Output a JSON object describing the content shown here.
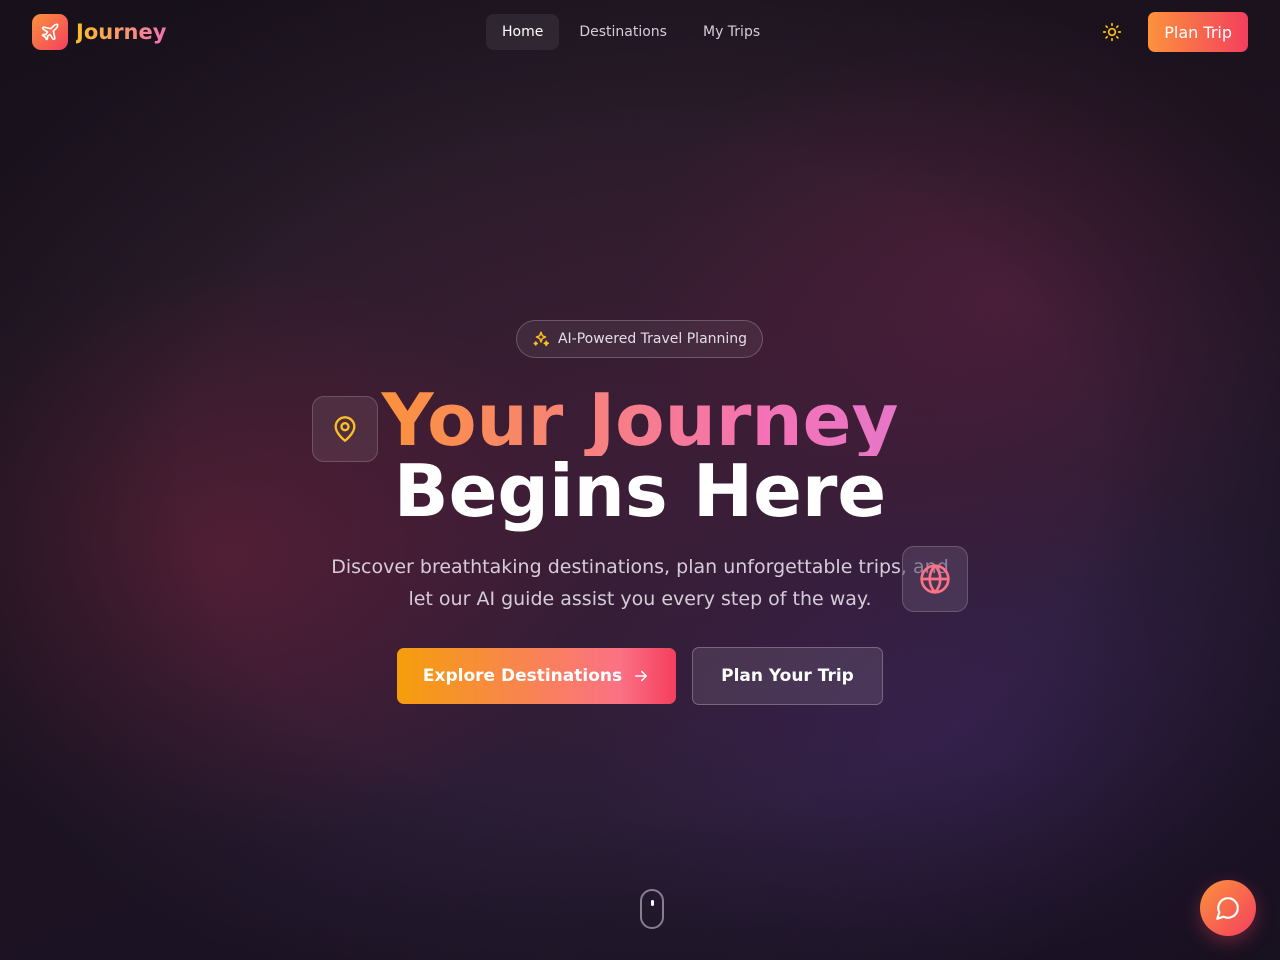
{
  "brand": {
    "name": "Journey",
    "icon": "plane-icon"
  },
  "nav": {
    "items": [
      {
        "label": "Home",
        "active": true
      },
      {
        "label": "Destinations",
        "active": false
      },
      {
        "label": "My Trips",
        "active": false
      }
    ]
  },
  "header": {
    "theme_toggle_icon": "sun-icon",
    "plan_trip_label": "Plan Trip"
  },
  "hero": {
    "badge": {
      "icon": "sparkles-icon",
      "label": "AI-Powered Travel Planning"
    },
    "title_part1": "Your",
    "title_part2": "Journey",
    "title_line2": "Begins Here",
    "subtitle_line1": "Discover breathtaking destinations, plan unforgettable trips, and",
    "subtitle_line2": "let our AI guide assist you every step of the way.",
    "primary_button": "Explore Destinations",
    "secondary_button": "Plan Your Trip",
    "floating_icons": [
      "map-pin-icon",
      "globe-icon"
    ]
  },
  "chat": {
    "icon": "message-circle-icon"
  },
  "colors": {
    "accent_orange": "#fb923c",
    "accent_rose": "#f43f5e",
    "accent_amber": "#fbbf24",
    "accent_purple": "#c084fc"
  }
}
